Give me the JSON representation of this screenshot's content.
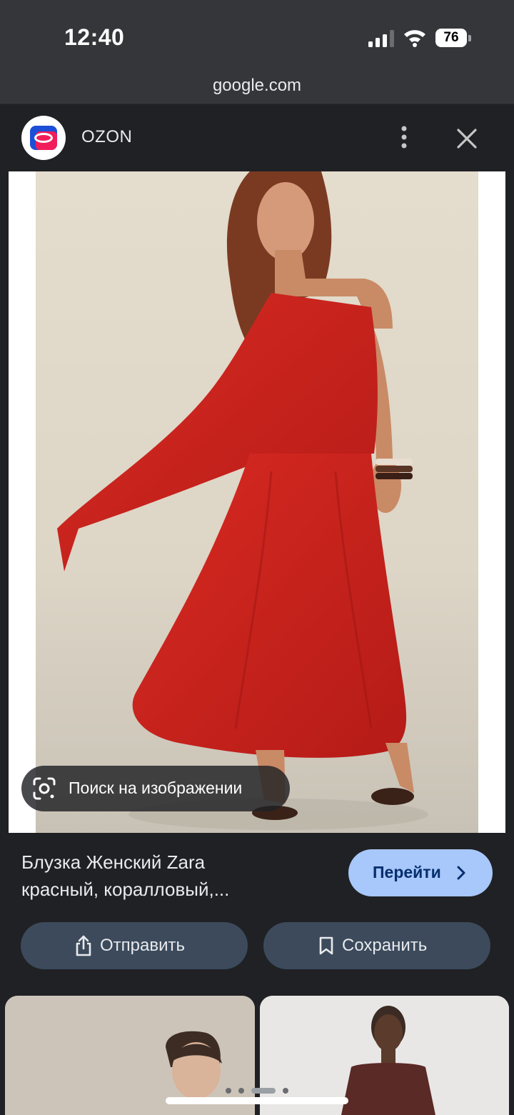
{
  "status_bar": {
    "time": "12:40",
    "battery": "76",
    "icons": [
      "signal-icon",
      "wifi-icon",
      "battery-icon"
    ]
  },
  "browser": {
    "url": "google.com"
  },
  "header": {
    "site_name": "OZON",
    "logo_icon": "ozon-logo",
    "more_icon": "more-vertical-icon",
    "close_icon": "close-icon"
  },
  "image": {
    "lens_label": "Поиск на изображении",
    "lens_icon": "google-lens-icon",
    "dominant_color": "#c9211e"
  },
  "result": {
    "title_line1": "Блузка Женский Zara",
    "title_line2": "красный, коралловый,...",
    "visit_label": "Перейти",
    "visit_icon": "chevron-right-icon"
  },
  "actions": {
    "share_label": "Отправить",
    "share_icon": "share-icon",
    "save_label": "Сохранить",
    "save_icon": "bookmark-icon"
  },
  "colors": {
    "accent": "#a8c7fa",
    "action_button_bg": "#3c4a5c",
    "page_bg": "#202124",
    "chrome_bar": "#35363a"
  }
}
